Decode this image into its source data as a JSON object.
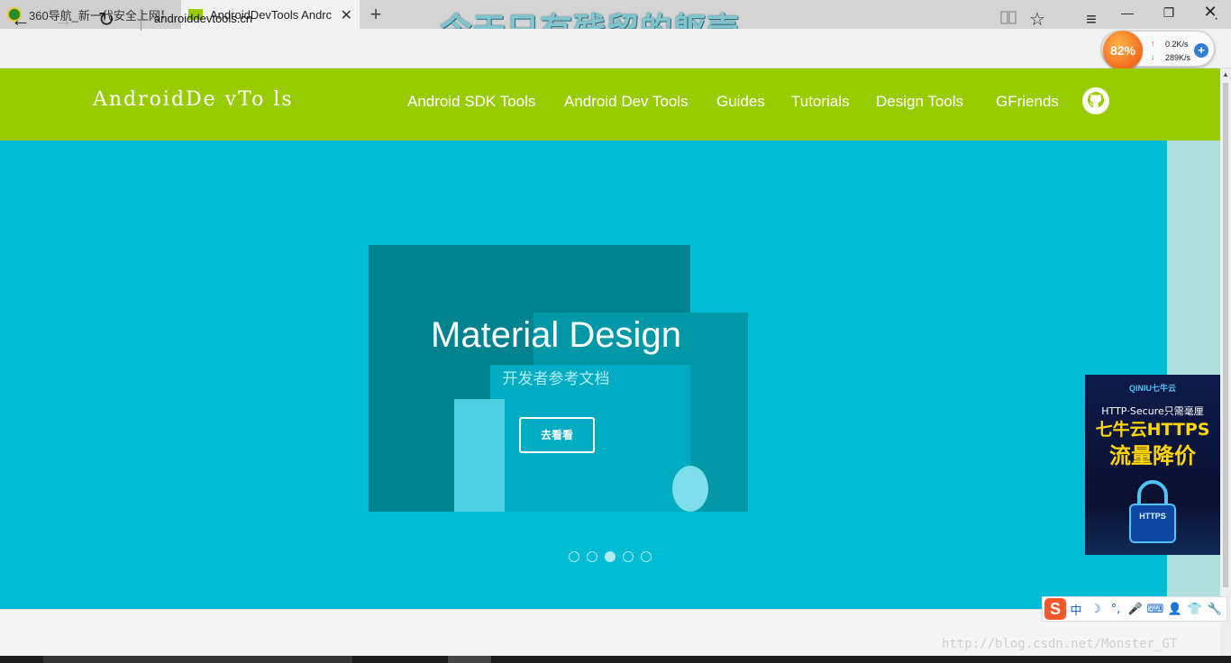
{
  "browser": {
    "tabs": [
      {
        "title": "360导航_新一代安全上网导"
      },
      {
        "title": "AndroidDevTools Andrc"
      }
    ],
    "new_tab": "+",
    "overlay_text": "今天只有残留的躯壳",
    "address": "androiddevtools.cn",
    "window": {
      "minimize": "—",
      "maximize": "❐",
      "close": "✕"
    },
    "nav": {
      "back": "←",
      "forward": "→",
      "refresh": "↻",
      "reading": "📖",
      "favorite": "☆",
      "hub": "≡",
      "more": "·"
    }
  },
  "speed_widget": {
    "percent": "82%",
    "upload": "0.2K/s",
    "download": "289K/s",
    "up_arrow": "↑",
    "down_arrow": "↓",
    "plus": "+"
  },
  "site": {
    "logo": "AndroidDe vTo ls",
    "menu": [
      "Android SDK Tools",
      "Android Dev Tools",
      "Guides",
      "Tutorials",
      "Design Tools",
      "GFriends"
    ],
    "brand_color": "#99cc00"
  },
  "hero": {
    "title": "Material Design",
    "subtitle": "开发者参考文档",
    "button": "去看看",
    "slide_count": 5,
    "active_slide": 3,
    "background": "#00bcd4"
  },
  "ad": {
    "brand": "QINIU七牛云",
    "line1": "HTTP·Secure只需毫厘",
    "line2": "七牛云HTTPS",
    "line3": "流量降价",
    "lock_text": "HTTPS"
  },
  "ime": {
    "logo": "S",
    "items": [
      "中",
      "☽",
      "°,",
      "🎤",
      "⌨",
      "👤",
      "👕",
      "🔧"
    ]
  },
  "watermark": "http://blog.csdn.net/Monster_GT"
}
